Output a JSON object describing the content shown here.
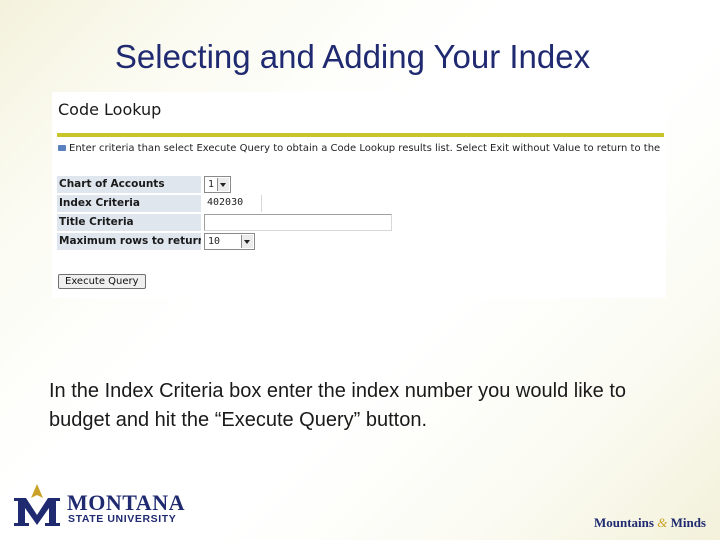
{
  "slide": {
    "title": "Selecting and Adding Your Index",
    "body_text": "In the Index Criteria box enter the index number you would like to budget and hit the “Execute Query” button."
  },
  "code_lookup": {
    "heading": "Code Lookup",
    "instruction": "Enter criteria than select Execute Query to obtain a Code Lookup results list. Select Exit without Value to return to the",
    "fields": {
      "chart_of_accounts": {
        "label": "Chart of Accounts",
        "value": "1"
      },
      "index_criteria": {
        "label": "Index Criteria",
        "value": "402030"
      },
      "title_criteria": {
        "label": "Title Criteria",
        "value": ""
      },
      "maximum_rows": {
        "label": "Maximum rows to return",
        "value": "10"
      }
    },
    "execute_button_label": "Execute Query"
  },
  "branding": {
    "logo_name": "MONTANA",
    "logo_sub": "STATE UNIVERSITY",
    "tagline_part1": "Mountains",
    "tagline_amp": "&",
    "tagline_part2": "Minds"
  },
  "colors": {
    "title_blue": "#1f2a70",
    "rule_yellow": "#c7c52a",
    "label_bg": "#dfe6ee",
    "gold": "#c9a227"
  }
}
